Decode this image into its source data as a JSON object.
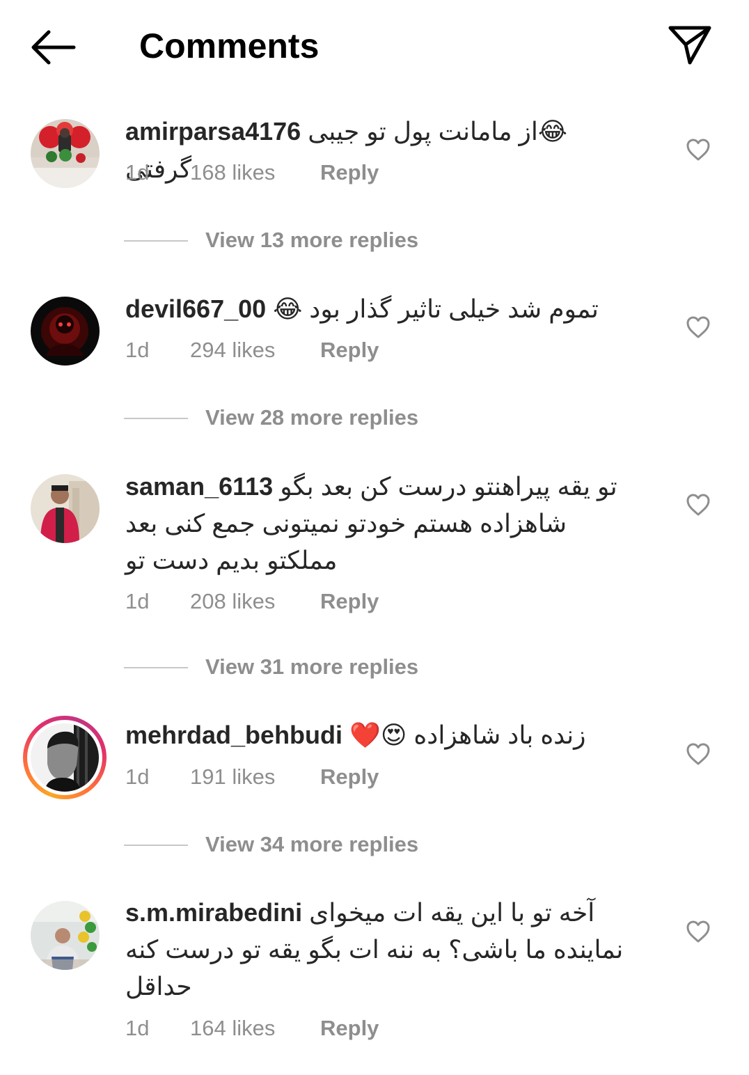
{
  "header": {
    "title": "Comments",
    "back_icon": "arrow-left-icon",
    "share_icon": "paper-plane-icon"
  },
  "comments": [
    {
      "username": "amirparsa4176",
      "text": "از مامانت پول تو جیبی گرفتی",
      "emoji": "😂",
      "time": "1d",
      "likes": "168 likes",
      "reply": "Reply",
      "view_replies": "View 13 more replies"
    },
    {
      "username": "devil667_00",
      "text": "تموم شد خیلی تاثیر گذار بود",
      "emoji": "😂",
      "time": "1d",
      "likes": "294 likes",
      "reply": "Reply",
      "view_replies": "View 28 more replies"
    },
    {
      "username": "saman_6113",
      "text": "تو یقه پیراهنتو درست کن بعد بگو شاهزاده هستم خودتو نمیتونی جمع کنی بعد مملکتو بدیم دست تو",
      "time": "1d",
      "likes": "208 likes",
      "reply": "Reply",
      "view_replies": "View 31 more replies"
    },
    {
      "username": "mehrdad_behbudi",
      "text": "زنده باد شاهزاده",
      "emoji": "😍❤️",
      "time": "1d",
      "likes": "191 likes",
      "reply": "Reply",
      "view_replies": "View 34 more replies"
    },
    {
      "username": "s.m.mirabedini",
      "text": "آخه تو با این یقه ات میخوای نماینده ما باشی؟ به ننه  ات بگو یقه تو درست کنه حداقل",
      "time": "1d",
      "likes": "164 likes",
      "reply": "Reply"
    }
  ],
  "colors": {
    "text": "#262626",
    "secondary": "#8e8e8e",
    "divider": "#c7c7c7",
    "story_ring": "#e1306c"
  }
}
